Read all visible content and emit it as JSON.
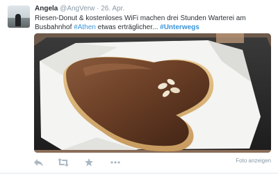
{
  "tweet": {
    "author_name": "Angela",
    "handle": "@AngVerw",
    "separator": "·",
    "date": "26. Apr.",
    "text_part1": "Riesen-Donut & kostenloses WiFi machen drei Stunden Warterei am Busbahnhof ",
    "hashtag1": "#Athen",
    "text_part2": " etwas erträglicher... ",
    "hashtag2": "#Unterwegs",
    "view_photo_label": "Foto anzeigen"
  },
  "icons": {
    "reply": "reply-icon",
    "retweet": "retweet-icon",
    "favorite": "star-icon",
    "more": "more-icon"
  },
  "colors": {
    "link": "#3b94d9",
    "text": "#292f33",
    "muted": "#8899a6",
    "icon": "#aab8c2"
  }
}
